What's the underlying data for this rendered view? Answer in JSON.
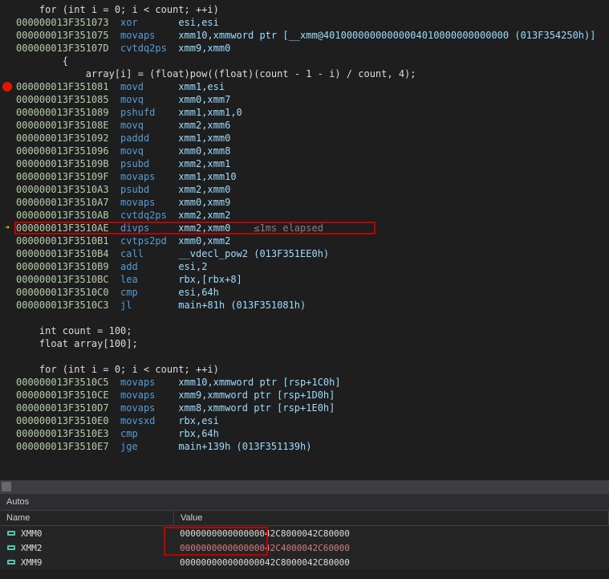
{
  "source": {
    "for1": "    for (int i = 0; i < count; ++i)",
    "brace": "        {",
    "expr": "            array[i] = (float)pow((float)(count - 1 - i) / count, 4);",
    "decl1": "    int count = 100;",
    "decl2": "    float array[100];",
    "for2": "    for (int i = 0; i < count; ++i)"
  },
  "lines": [
    {
      "addr": "000000013F351073",
      "mn": "xor",
      "op": "esi,esi"
    },
    {
      "addr": "000000013F351075",
      "mn": "movaps",
      "op": "xmm10,xmmword ptr [__xmm@40100000000000004010000000000000 (013F354250h)]"
    },
    {
      "addr": "000000013F35107D",
      "mn": "cvtdq2ps",
      "op": "xmm9,xmm0"
    },
    {
      "addr": "000000013F351081",
      "mn": "movd",
      "op": "xmm1,esi"
    },
    {
      "addr": "000000013F351085",
      "mn": "movq",
      "op": "xmm0,xmm7"
    },
    {
      "addr": "000000013F351089",
      "mn": "pshufd",
      "op": "xmm1,xmm1,0"
    },
    {
      "addr": "000000013F35108E",
      "mn": "movq",
      "op": "xmm2,xmm6"
    },
    {
      "addr": "000000013F351092",
      "mn": "paddd",
      "op": "xmm1,xmm0"
    },
    {
      "addr": "000000013F351096",
      "mn": "movq",
      "op": "xmm0,xmm8"
    },
    {
      "addr": "000000013F35109B",
      "mn": "psubd",
      "op": "xmm2,xmm1"
    },
    {
      "addr": "000000013F35109F",
      "mn": "movaps",
      "op": "xmm1,xmm10"
    },
    {
      "addr": "000000013F3510A3",
      "mn": "psubd",
      "op": "xmm2,xmm0"
    },
    {
      "addr": "000000013F3510A7",
      "mn": "movaps",
      "op": "xmm0,xmm9"
    },
    {
      "addr": "000000013F3510AB",
      "mn": "cvtdq2ps",
      "op": "xmm2,xmm2"
    },
    {
      "addr": "000000013F3510AE",
      "mn": "divps",
      "op": "xmm2,xmm0",
      "elapsed": "≤1ms elapsed"
    },
    {
      "addr": "000000013F3510B1",
      "mn": "cvtps2pd",
      "op": "xmm0,xmm2"
    },
    {
      "addr": "000000013F3510B4",
      "mn": "call",
      "op": "__vdecl_pow2 (013F351EE0h)"
    },
    {
      "addr": "000000013F3510B9",
      "mn": "add",
      "op": "esi,2"
    },
    {
      "addr": "000000013F3510BC",
      "mn": "lea",
      "op": "rbx,[rbx+8]"
    },
    {
      "addr": "000000013F3510C0",
      "mn": "cmp",
      "op": "esi,64h"
    },
    {
      "addr": "000000013F3510C3",
      "mn": "jl",
      "op": "main+81h (013F351081h)"
    },
    {
      "addr": "000000013F3510C5",
      "mn": "movaps",
      "op": "xmm10,xmmword ptr [rsp+1C0h]"
    },
    {
      "addr": "000000013F3510CE",
      "mn": "movaps",
      "op": "xmm9,xmmword ptr [rsp+1D0h]"
    },
    {
      "addr": "000000013F3510D7",
      "mn": "movaps",
      "op": "xmm8,xmmword ptr [rsp+1E0h]"
    },
    {
      "addr": "000000013F3510E0",
      "mn": "movsxd",
      "op": "rbx,esi"
    },
    {
      "addr": "000000013F3510E3",
      "mn": "cmp",
      "op": "rbx,64h"
    },
    {
      "addr": "000000013F3510E7",
      "mn": "jge",
      "op": "main+139h (013F351139h)"
    }
  ],
  "autos": {
    "title": "Autos",
    "header_name": "Name",
    "header_value": "Value",
    "rows": [
      {
        "name": "XMM0",
        "value": "000000000000000042C8000042C80000",
        "changed": false
      },
      {
        "name": "XMM2",
        "value": "000000000000000042C4000042C60000",
        "changed": true
      },
      {
        "name": "XMM9",
        "value": "000000000000000042C8000042C80000",
        "changed": false
      }
    ]
  }
}
